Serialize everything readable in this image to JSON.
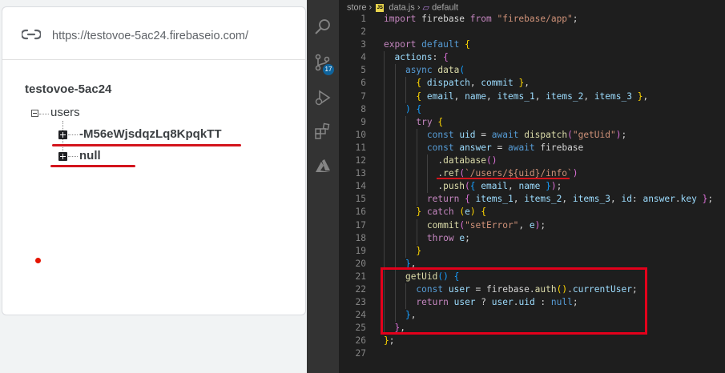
{
  "firebase": {
    "url": "https://testovoe-5ac24.firebaseio.com/",
    "root_key": "testovoe-5ac24",
    "child_key": "users",
    "nodes": [
      "-M56eWjsdqzLq8KpqkTT",
      "null"
    ]
  },
  "editor": {
    "breadcrumb": [
      "store",
      "data.js",
      "default"
    ],
    "file_badge": "JS",
    "notification_count": "17",
    "icons": [
      "search-icon",
      "source-control-icon",
      "run-debug-icon",
      "extensions-icon",
      "azure-icon"
    ],
    "colors": {
      "highlight": "#e3001b",
      "breakpoint": "#e51400",
      "underline": "#d3141c"
    },
    "lines": [
      {
        "n": "1",
        "text": "import firebase from \"firebase/app\";"
      },
      {
        "n": "2",
        "text": ""
      },
      {
        "n": "3",
        "text": "export default {"
      },
      {
        "n": "4",
        "text": "  actions: {"
      },
      {
        "n": "5",
        "text": "    async data("
      },
      {
        "n": "6",
        "text": "      { dispatch, commit },"
      },
      {
        "n": "7",
        "text": "      { email, name, items_1, items_2, items_3 },"
      },
      {
        "n": "8",
        "text": "    ) {"
      },
      {
        "n": "9",
        "text": "      try {"
      },
      {
        "n": "10",
        "text": "        const uid = await dispatch(\"getUid\");"
      },
      {
        "n": "11",
        "text": "        const answer = await firebase"
      },
      {
        "n": "12",
        "text": "          .database()"
      },
      {
        "n": "13",
        "text": "          .ref(`/users/${uid}/info`)"
      },
      {
        "n": "14",
        "text": "          .push({ email, name });"
      },
      {
        "n": "15",
        "text": "        return { items_1, items_2, items_3, id: answer.key };"
      },
      {
        "n": "16",
        "text": "      } catch (e) {"
      },
      {
        "n": "17",
        "text": "        commit(\"setError\", e);"
      },
      {
        "n": "18",
        "text": "        throw e;"
      },
      {
        "n": "19",
        "text": "      }"
      },
      {
        "n": "20",
        "text": "    },"
      },
      {
        "n": "21",
        "text": "    getUid() {"
      },
      {
        "n": "22",
        "text": "      const user = firebase.auth().currentUser;"
      },
      {
        "n": "23",
        "text": "      return user ? user.uid : null;"
      },
      {
        "n": "24",
        "text": "    },"
      },
      {
        "n": "25",
        "text": "  },"
      },
      {
        "n": "26",
        "text": "};"
      },
      {
        "n": "27",
        "text": ""
      }
    ]
  }
}
